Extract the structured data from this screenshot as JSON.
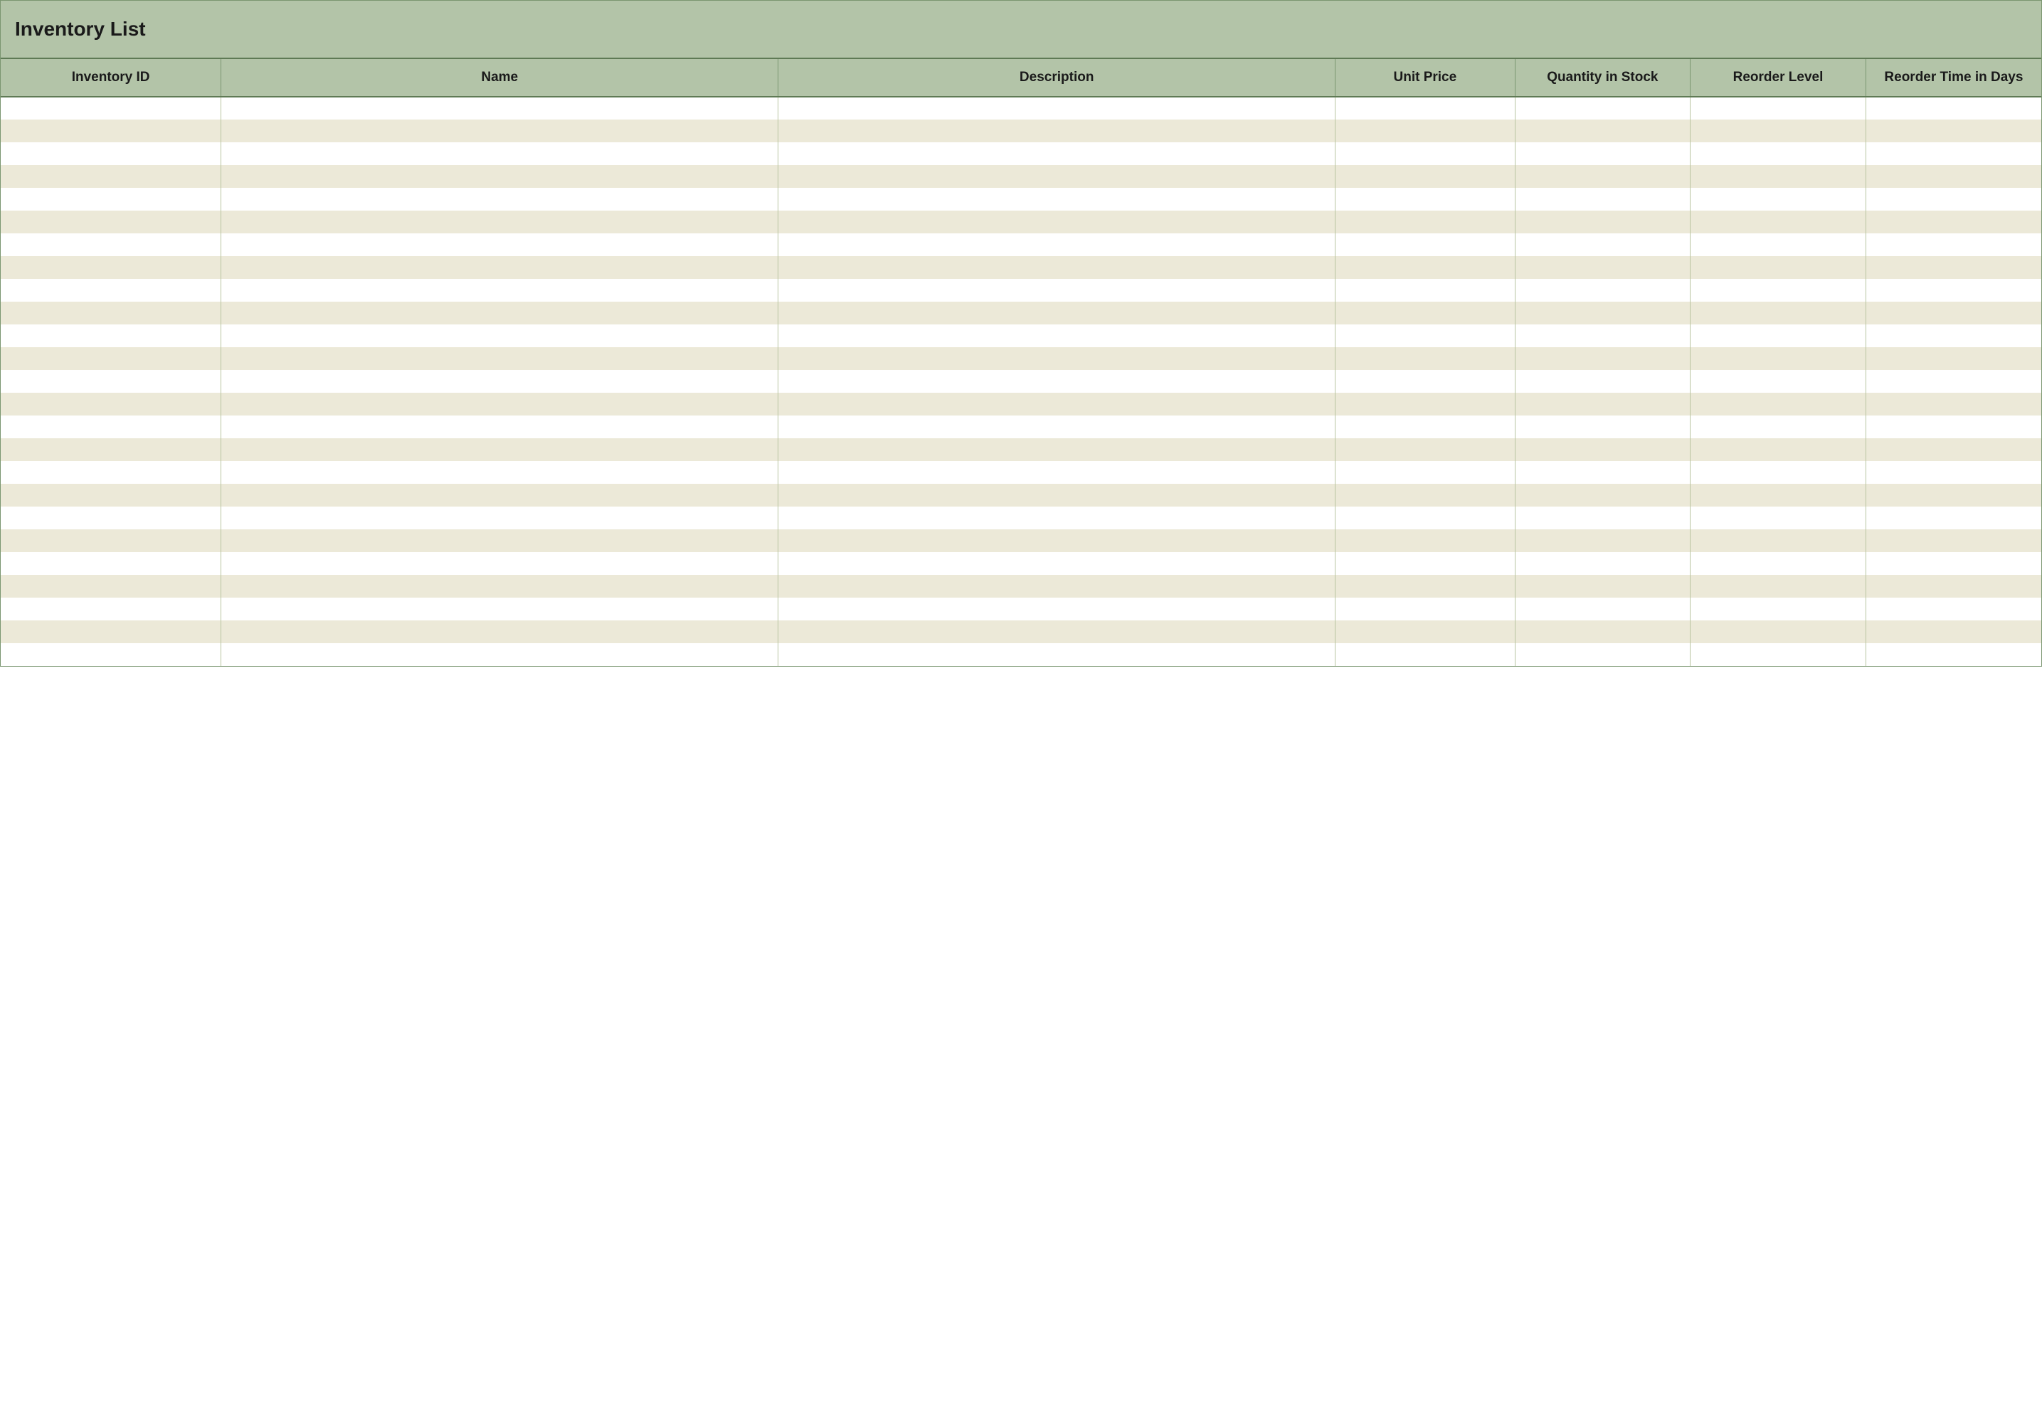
{
  "title": "Inventory List",
  "columns": [
    {
      "key": "inventory_id",
      "label": "Inventory ID"
    },
    {
      "key": "name",
      "label": "Name"
    },
    {
      "key": "description",
      "label": "Description"
    },
    {
      "key": "unit_price",
      "label": "Unit Price"
    },
    {
      "key": "quantity_in_stock",
      "label": "Quantity in Stock"
    },
    {
      "key": "reorder_level",
      "label": "Reorder Level"
    },
    {
      "key": "reorder_time_in_days",
      "label": "Reorder Time in Days"
    }
  ],
  "rows": [
    {
      "inventory_id": "",
      "name": "",
      "description": "",
      "unit_price": "",
      "quantity_in_stock": "",
      "reorder_level": "",
      "reorder_time_in_days": ""
    },
    {
      "inventory_id": "",
      "name": "",
      "description": "",
      "unit_price": "",
      "quantity_in_stock": "",
      "reorder_level": "",
      "reorder_time_in_days": ""
    },
    {
      "inventory_id": "",
      "name": "",
      "description": "",
      "unit_price": "",
      "quantity_in_stock": "",
      "reorder_level": "",
      "reorder_time_in_days": ""
    },
    {
      "inventory_id": "",
      "name": "",
      "description": "",
      "unit_price": "",
      "quantity_in_stock": "",
      "reorder_level": "",
      "reorder_time_in_days": ""
    },
    {
      "inventory_id": "",
      "name": "",
      "description": "",
      "unit_price": "",
      "quantity_in_stock": "",
      "reorder_level": "",
      "reorder_time_in_days": ""
    },
    {
      "inventory_id": "",
      "name": "",
      "description": "",
      "unit_price": "",
      "quantity_in_stock": "",
      "reorder_level": "",
      "reorder_time_in_days": ""
    },
    {
      "inventory_id": "",
      "name": "",
      "description": "",
      "unit_price": "",
      "quantity_in_stock": "",
      "reorder_level": "",
      "reorder_time_in_days": ""
    },
    {
      "inventory_id": "",
      "name": "",
      "description": "",
      "unit_price": "",
      "quantity_in_stock": "",
      "reorder_level": "",
      "reorder_time_in_days": ""
    },
    {
      "inventory_id": "",
      "name": "",
      "description": "",
      "unit_price": "",
      "quantity_in_stock": "",
      "reorder_level": "",
      "reorder_time_in_days": ""
    },
    {
      "inventory_id": "",
      "name": "",
      "description": "",
      "unit_price": "",
      "quantity_in_stock": "",
      "reorder_level": "",
      "reorder_time_in_days": ""
    },
    {
      "inventory_id": "",
      "name": "",
      "description": "",
      "unit_price": "",
      "quantity_in_stock": "",
      "reorder_level": "",
      "reorder_time_in_days": ""
    },
    {
      "inventory_id": "",
      "name": "",
      "description": "",
      "unit_price": "",
      "quantity_in_stock": "",
      "reorder_level": "",
      "reorder_time_in_days": ""
    },
    {
      "inventory_id": "",
      "name": "",
      "description": "",
      "unit_price": "",
      "quantity_in_stock": "",
      "reorder_level": "",
      "reorder_time_in_days": ""
    },
    {
      "inventory_id": "",
      "name": "",
      "description": "",
      "unit_price": "",
      "quantity_in_stock": "",
      "reorder_level": "",
      "reorder_time_in_days": ""
    },
    {
      "inventory_id": "",
      "name": "",
      "description": "",
      "unit_price": "",
      "quantity_in_stock": "",
      "reorder_level": "",
      "reorder_time_in_days": ""
    },
    {
      "inventory_id": "",
      "name": "",
      "description": "",
      "unit_price": "",
      "quantity_in_stock": "",
      "reorder_level": "",
      "reorder_time_in_days": ""
    },
    {
      "inventory_id": "",
      "name": "",
      "description": "",
      "unit_price": "",
      "quantity_in_stock": "",
      "reorder_level": "",
      "reorder_time_in_days": ""
    },
    {
      "inventory_id": "",
      "name": "",
      "description": "",
      "unit_price": "",
      "quantity_in_stock": "",
      "reorder_level": "",
      "reorder_time_in_days": ""
    },
    {
      "inventory_id": "",
      "name": "",
      "description": "",
      "unit_price": "",
      "quantity_in_stock": "",
      "reorder_level": "",
      "reorder_time_in_days": ""
    },
    {
      "inventory_id": "",
      "name": "",
      "description": "",
      "unit_price": "",
      "quantity_in_stock": "",
      "reorder_level": "",
      "reorder_time_in_days": ""
    },
    {
      "inventory_id": "",
      "name": "",
      "description": "",
      "unit_price": "",
      "quantity_in_stock": "",
      "reorder_level": "",
      "reorder_time_in_days": ""
    },
    {
      "inventory_id": "",
      "name": "",
      "description": "",
      "unit_price": "",
      "quantity_in_stock": "",
      "reorder_level": "",
      "reorder_time_in_days": ""
    },
    {
      "inventory_id": "",
      "name": "",
      "description": "",
      "unit_price": "",
      "quantity_in_stock": "",
      "reorder_level": "",
      "reorder_time_in_days": ""
    },
    {
      "inventory_id": "",
      "name": "",
      "description": "",
      "unit_price": "",
      "quantity_in_stock": "",
      "reorder_level": "",
      "reorder_time_in_days": ""
    },
    {
      "inventory_id": "",
      "name": "",
      "description": "",
      "unit_price": "",
      "quantity_in_stock": "",
      "reorder_level": "",
      "reorder_time_in_days": ""
    }
  ]
}
